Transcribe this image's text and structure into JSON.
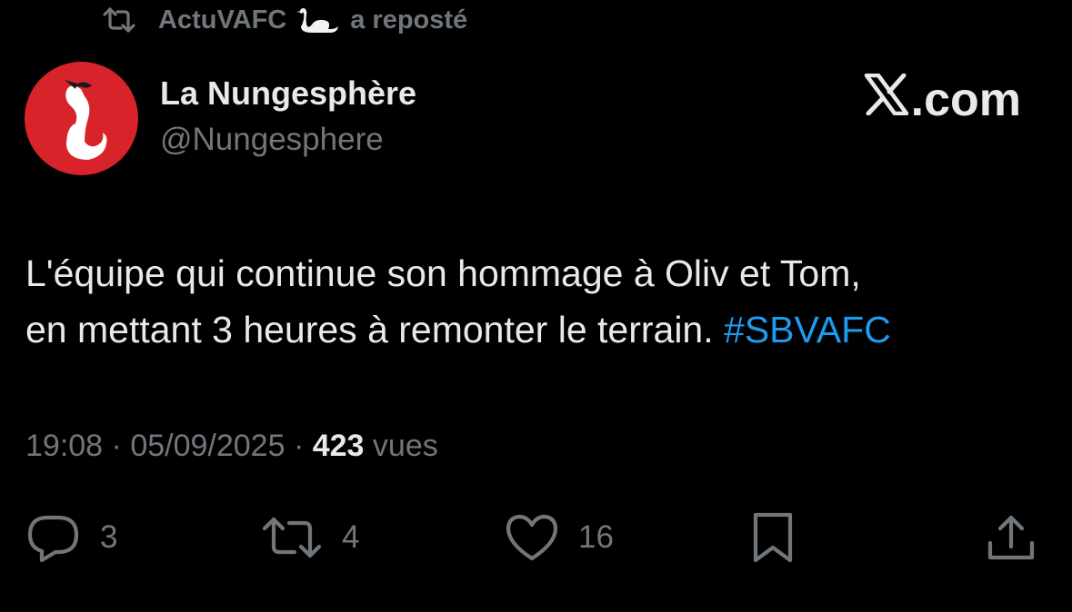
{
  "repost": {
    "account": "ActuVAFC",
    "suffix": "a reposté",
    "icon": "repost-icon",
    "emoji_icon": "swan-emoji-icon"
  },
  "author": {
    "display_name": "La Nungesphère",
    "handle": "@Nungesphere",
    "avatar_icon": "swan-logo-icon",
    "avatar_color": "#d8232a"
  },
  "brand": {
    "icon": "x-logo-icon",
    "text": ".com"
  },
  "tweet": {
    "line1": "L'équipe qui continue son hommage à Oliv et Tom,",
    "line2": "en mettant 3 heures à remonter le terrain.",
    "hashtag": "#SBVAFC"
  },
  "meta": {
    "time": "19:08",
    "separator": "·",
    "date": "05/09/2025",
    "views_count": "423",
    "views_label": "vues"
  },
  "actions": {
    "reply": {
      "icon": "reply-icon",
      "count": "3"
    },
    "repost": {
      "icon": "repost-icon",
      "count": "4"
    },
    "like": {
      "icon": "heart-icon",
      "count": "16"
    },
    "bookmark": {
      "icon": "bookmark-icon"
    },
    "share": {
      "icon": "share-icon"
    }
  },
  "colors": {
    "background": "#000000",
    "primary_text": "#e7e9ea",
    "secondary_text": "#71767b",
    "link": "#1d9bf0"
  }
}
